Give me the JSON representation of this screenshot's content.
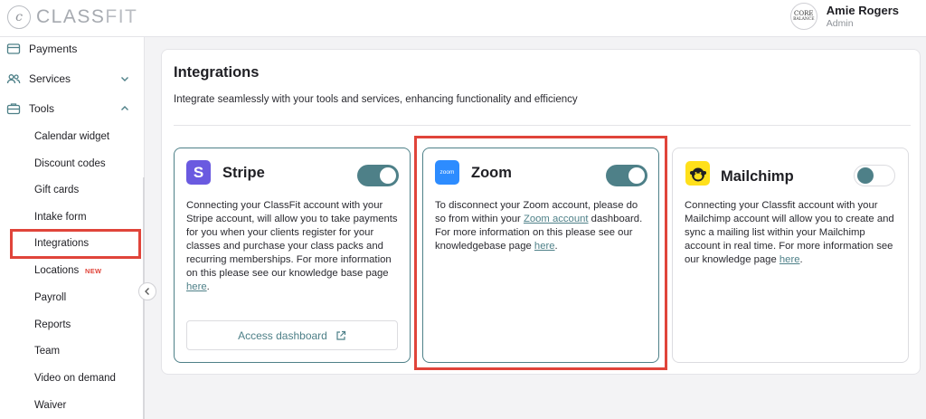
{
  "app": {
    "logo_mark": "c",
    "logo_text_a": "CLASS",
    "logo_text_b": "FIT"
  },
  "user": {
    "avatar_line1": "CORE",
    "avatar_line2": "BALANCE",
    "name": "Amie Rogers",
    "role": "Admin"
  },
  "sidebar": {
    "items": [
      {
        "label": "Payments",
        "icon": "credit-card-icon"
      },
      {
        "label": "Services",
        "icon": "users-icon",
        "chevron": "chevron-down-icon"
      },
      {
        "label": "Tools",
        "icon": "briefcase-icon",
        "chevron": "chevron-up-icon"
      }
    ],
    "subitems": [
      {
        "label": "Calendar widget"
      },
      {
        "label": "Discount codes"
      },
      {
        "label": "Gift cards"
      },
      {
        "label": "Intake form"
      },
      {
        "label": "Integrations",
        "active": true
      },
      {
        "label": "Locations",
        "badge": "NEW"
      },
      {
        "label": "Payroll"
      },
      {
        "label": "Reports"
      },
      {
        "label": "Team"
      },
      {
        "label": "Video on demand"
      },
      {
        "label": "Waiver"
      }
    ],
    "collapse_icon": "chevron-left-icon"
  },
  "main": {
    "title": "Integrations",
    "subtitle": "Integrate seamlessly with your tools and services, enhancing functionality and efficiency",
    "cards": [
      {
        "name": "Stripe",
        "enabled": true,
        "logo_letter": "S",
        "desc_text": "Connecting your ClassFit account with your Stripe account, will allow you to take payments for you when your clients register for your classes and purchase your class packs and recurring memberships. For more information on this please see our knowledge base page ",
        "link_text": "here",
        "desc_end": ".",
        "button_label": "Access dashboard",
        "button_icon": "external-link-icon"
      },
      {
        "name": "Zoom",
        "enabled": true,
        "logo_text": "zoom",
        "desc_text_1": "To disconnect your Zoom account, please do so from within your ",
        "link_text_1": "Zoom account",
        "desc_text_2": " dashboard. For more information on this please see our knowledgebase page ",
        "link_text_2": "here",
        "desc_end": "."
      },
      {
        "name": "Mailchimp",
        "enabled": false,
        "desc_text": "Connecting your Classfit account with your Mailchimp account will allow you to create and sync a mailing list within your Mailchimp account in real time. For more information see our knowledge page ",
        "link_text": "here",
        "desc_end": "."
      }
    ]
  },
  "colors": {
    "accent": "#4e8088",
    "stripe": "#6a5ae0",
    "zoom": "#2d8cff",
    "mailchimp": "#ffe01b",
    "highlight": "#e0443a"
  }
}
